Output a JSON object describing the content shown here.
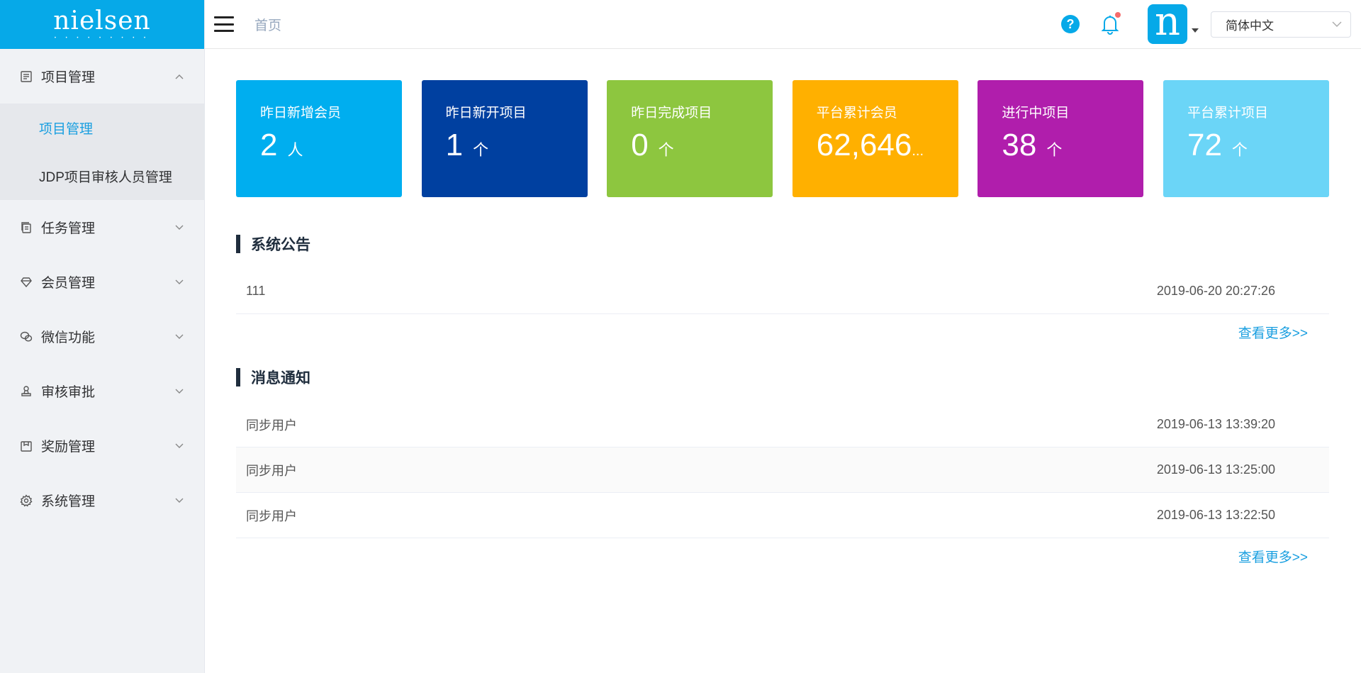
{
  "logo": {
    "text": "nielsen",
    "dots": "• • • • • • • • •"
  },
  "sidebar": {
    "items": [
      {
        "label": "项目管理",
        "expanded": true,
        "sub": [
          {
            "label": "项目管理",
            "active": true
          },
          {
            "label": "JDP项目审核人员管理",
            "active": false
          }
        ]
      },
      {
        "label": "任务管理"
      },
      {
        "label": "会员管理"
      },
      {
        "label": "微信功能"
      },
      {
        "label": "审核审批"
      },
      {
        "label": "奖励管理"
      },
      {
        "label": "系统管理"
      }
    ]
  },
  "header": {
    "breadcrumb": "首页",
    "help": "?",
    "avatar_letter": "n",
    "language": "简体中文"
  },
  "stats": [
    {
      "title": "昨日新增会员",
      "value": "2",
      "unit": "人",
      "color": "#00aeef"
    },
    {
      "title": "昨日新开项目",
      "value": "1",
      "unit": "个",
      "color": "#0040a0"
    },
    {
      "title": "昨日完成项目",
      "value": "0",
      "unit": "个",
      "color": "#8dc63f"
    },
    {
      "title": "平台累计会员",
      "value": "62,646",
      "unit": "...",
      "color": "#ffb000"
    },
    {
      "title": "进行中项目",
      "value": "38",
      "unit": "个",
      "color": "#b01eac"
    },
    {
      "title": "平台累计项目",
      "value": "72",
      "unit": "个",
      "color": "#6bd5f7"
    }
  ],
  "announcements": {
    "title": "系统公告",
    "rows": [
      {
        "text": "111",
        "time": "2019-06-20 20:27:26"
      }
    ],
    "more": "查看更多>>"
  },
  "messages": {
    "title": "消息通知",
    "rows": [
      {
        "text": "同步用户",
        "time": "2019-06-13 13:39:20"
      },
      {
        "text": "同步用户",
        "time": "2019-06-13 13:25:00"
      },
      {
        "text": "同步用户",
        "time": "2019-06-13 13:22:50"
      }
    ],
    "more": "查看更多>>"
  }
}
